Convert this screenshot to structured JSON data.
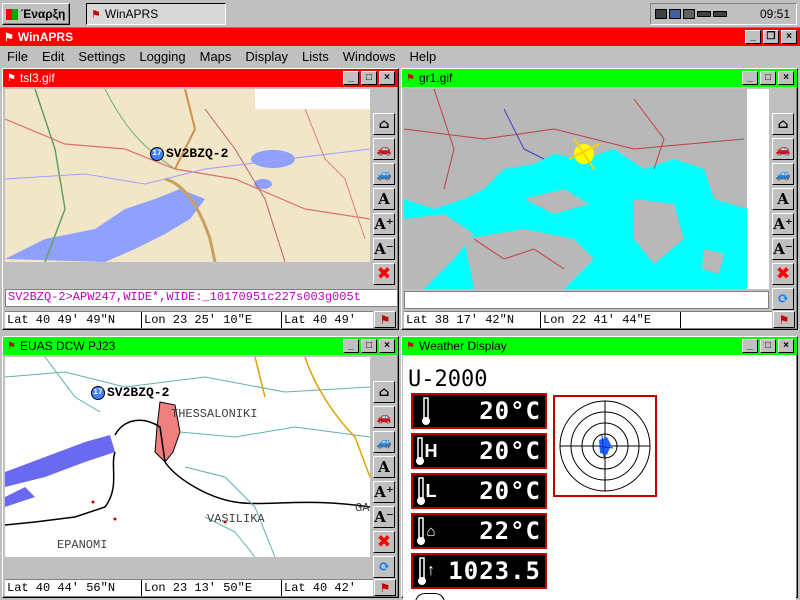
{
  "taskbar": {
    "start_label": "Έναρξη",
    "task_label": "WinAPRS",
    "clock": "09:51"
  },
  "app": {
    "title": "WinAPRS"
  },
  "menu": [
    "File",
    "Edit",
    "Settings",
    "Logging",
    "Maps",
    "Display",
    "Lists",
    "Windows",
    "Help"
  ],
  "windows": {
    "tsl3": {
      "title": "tsl3.gif",
      "station": "SV2BZQ-2",
      "packet": "SV2BZQ-2>APW247,WIDE*,WIDE:_10170951c227s003g005t",
      "status": [
        "Lat  40 49' 49\"N",
        "Lon  23 25' 10\"E",
        "Lat  40 49'"
      ]
    },
    "gr1": {
      "title": "gr1.gif",
      "status": [
        "Lat  38 17' 42\"N",
        "Lon  22 41' 44\"E"
      ]
    },
    "euas": {
      "title": "EUAS DCW PJ23",
      "station": "SV2BZQ-2",
      "places": [
        "THESSALONIKI",
        "VASILIKA",
        "EPANOMI",
        "GA"
      ],
      "status": [
        "Lat  40 44' 56\"N",
        "Lon  23 13' 50\"E",
        "Lat  40 42'"
      ]
    },
    "weather": {
      "title": "Weather Display",
      "model": "U-2000",
      "readings": [
        {
          "icon": "thermometer-icon",
          "glyph": "🌡",
          "value": "20°C"
        },
        {
          "icon": "thermometer-high-icon",
          "glyph": "H",
          "value": "20°C"
        },
        {
          "icon": "thermometer-low-icon",
          "glyph": "L",
          "value": "20°C"
        },
        {
          "icon": "indoor-temp-icon",
          "glyph": "⌂",
          "value": "22°C"
        },
        {
          "icon": "pressure-rising-icon",
          "glyph": "↑",
          "value": "1023.5"
        }
      ]
    }
  },
  "colors": {
    "active_title": "#ff0000",
    "inactive_title": "#00ff00",
    "sea": "#00ffff",
    "packet_text": "#c000c0"
  }
}
